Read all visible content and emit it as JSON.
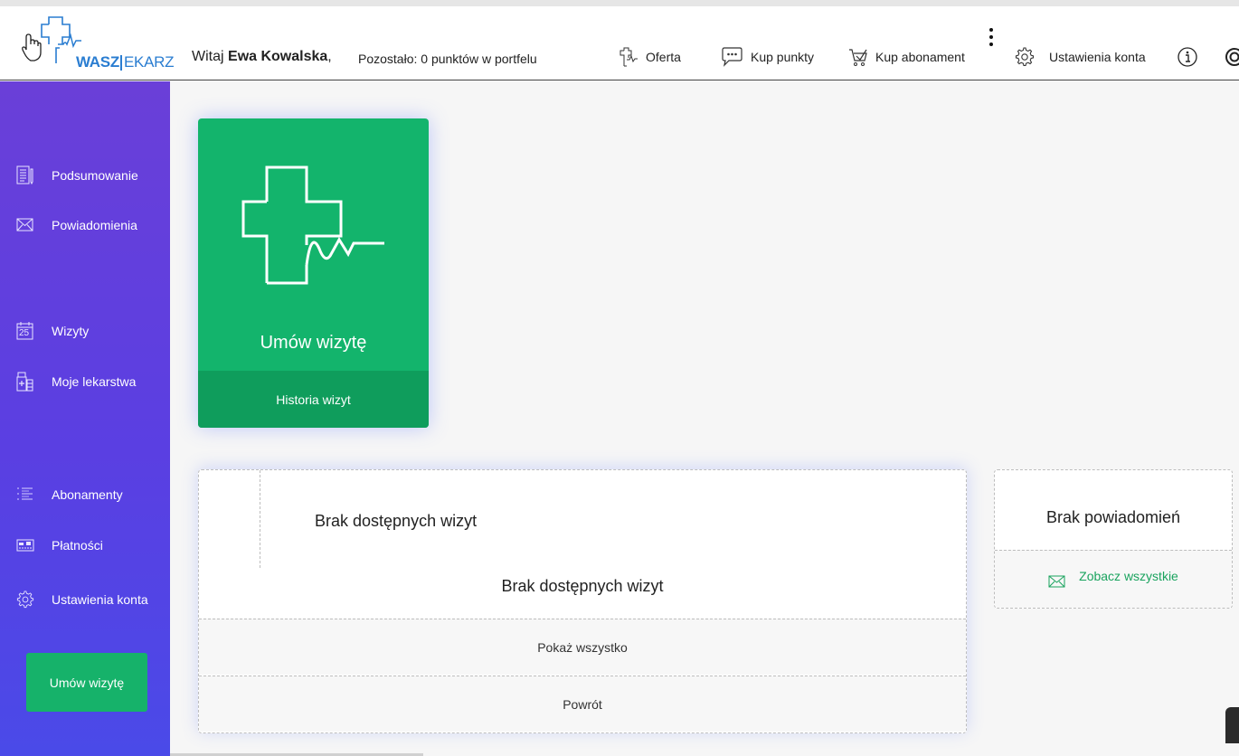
{
  "logo": {
    "wasz": "WASZ",
    "lekarz": "EKARZ"
  },
  "header": {
    "greeting_prefix": "Witaj",
    "user_name": "Ewa Kowalska",
    "greeting_suffix": ",",
    "points_text": "Pozostało: 0 punktów w portfelu",
    "nav": {
      "offer": "Oferta",
      "buy_points": "Kup punkty",
      "buy_subscription": "Kup abonament",
      "account_settings": "Ustawienia konta"
    }
  },
  "sidebar": {
    "items": [
      {
        "label": "Podsumowanie",
        "icon": "summary-icon"
      },
      {
        "label": "Powiadomienia",
        "icon": "envelope-icon"
      },
      {
        "label": "Wizyty",
        "icon": "calendar-icon",
        "icon_text": "25"
      },
      {
        "label": "Moje lekarstwa",
        "icon": "pharmacy-icon"
      },
      {
        "label": "Abonamenty",
        "icon": "list-icon"
      },
      {
        "label": "Płatności",
        "icon": "card-icon"
      },
      {
        "label": "Ustawienia konta",
        "icon": "gear-icon"
      }
    ],
    "cta": "Umów wizytę"
  },
  "book_card": {
    "title": "Umów wizytę",
    "footer": "Historia wizyt"
  },
  "visits": {
    "subtitle": "Brak dostępnych wizyt",
    "main": "Brak dostępnych wizyt",
    "show_all": "Pokaż wszystko",
    "back": "Powrót"
  },
  "notifications": {
    "title": "Brak powiadomień",
    "see_all": "Zobacz wszystkie"
  },
  "colors": {
    "accent_green": "#13b46c",
    "sidebar_purple": "#6a3fd8",
    "sidebar_blue": "#4a4ae8",
    "link_green": "#1aa35e"
  }
}
